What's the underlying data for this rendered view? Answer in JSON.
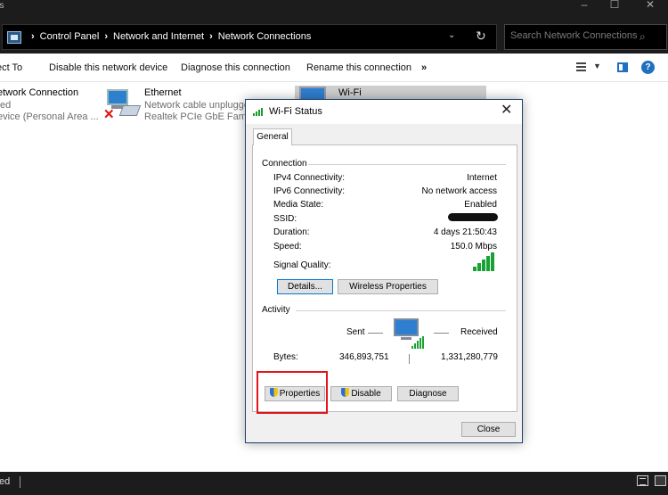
{
  "window": {
    "title_fragment": "ns",
    "controls": [
      "–",
      "☐",
      "✕"
    ]
  },
  "address": {
    "breadcrumbs": [
      "Control Panel",
      "Network and Internet",
      "Network Connections"
    ],
    "search_placeholder": "Search Network Connections"
  },
  "commands": {
    "connect_to": "ect To",
    "disable_device": "Disable this network device",
    "diagnose": "Diagnose this connection",
    "rename": "Rename this connection",
    "more": "»"
  },
  "connections": [
    {
      "name": "etwork Connection",
      "line2": "ted",
      "line3": "evice (Personal Area ..."
    },
    {
      "name": "Ethernet",
      "line2": "Network cable unplugged",
      "line3": "Realtek PCIe GbE Family C"
    },
    {
      "name": "Wi-Fi"
    }
  ],
  "statusbar": {
    "text": "ted"
  },
  "dialog": {
    "title": "Wi-Fi Status",
    "tab": "General",
    "connection_label": "Connection",
    "rows": [
      {
        "label": "IPv4 Connectivity:",
        "value": "Internet"
      },
      {
        "label": "IPv6 Connectivity:",
        "value": "No network access"
      },
      {
        "label": "Media State:",
        "value": "Enabled"
      },
      {
        "label": "SSID:",
        "value": ""
      },
      {
        "label": "Duration:",
        "value": "4 days 21:50:43"
      },
      {
        "label": "Speed:",
        "value": "150.0 Mbps"
      }
    ],
    "signal_label": "Signal Quality:",
    "signal_level": "5/5",
    "details_button": "Details...",
    "wireless_button": "Wireless Properties",
    "activity_label": "Activity",
    "sent_label": "Sent",
    "received_label": "Received",
    "bytes_label": "Bytes:",
    "bytes_sent": "346,893,751",
    "bytes_received": "1,331,280,779",
    "properties_button": "Properties",
    "disable_button": "Disable",
    "diagnose_button": "Diagnose",
    "close_button": "Close"
  },
  "colors": {
    "highlight": "#e2141c",
    "accent": "#0078d7",
    "signal": "#17a233"
  }
}
